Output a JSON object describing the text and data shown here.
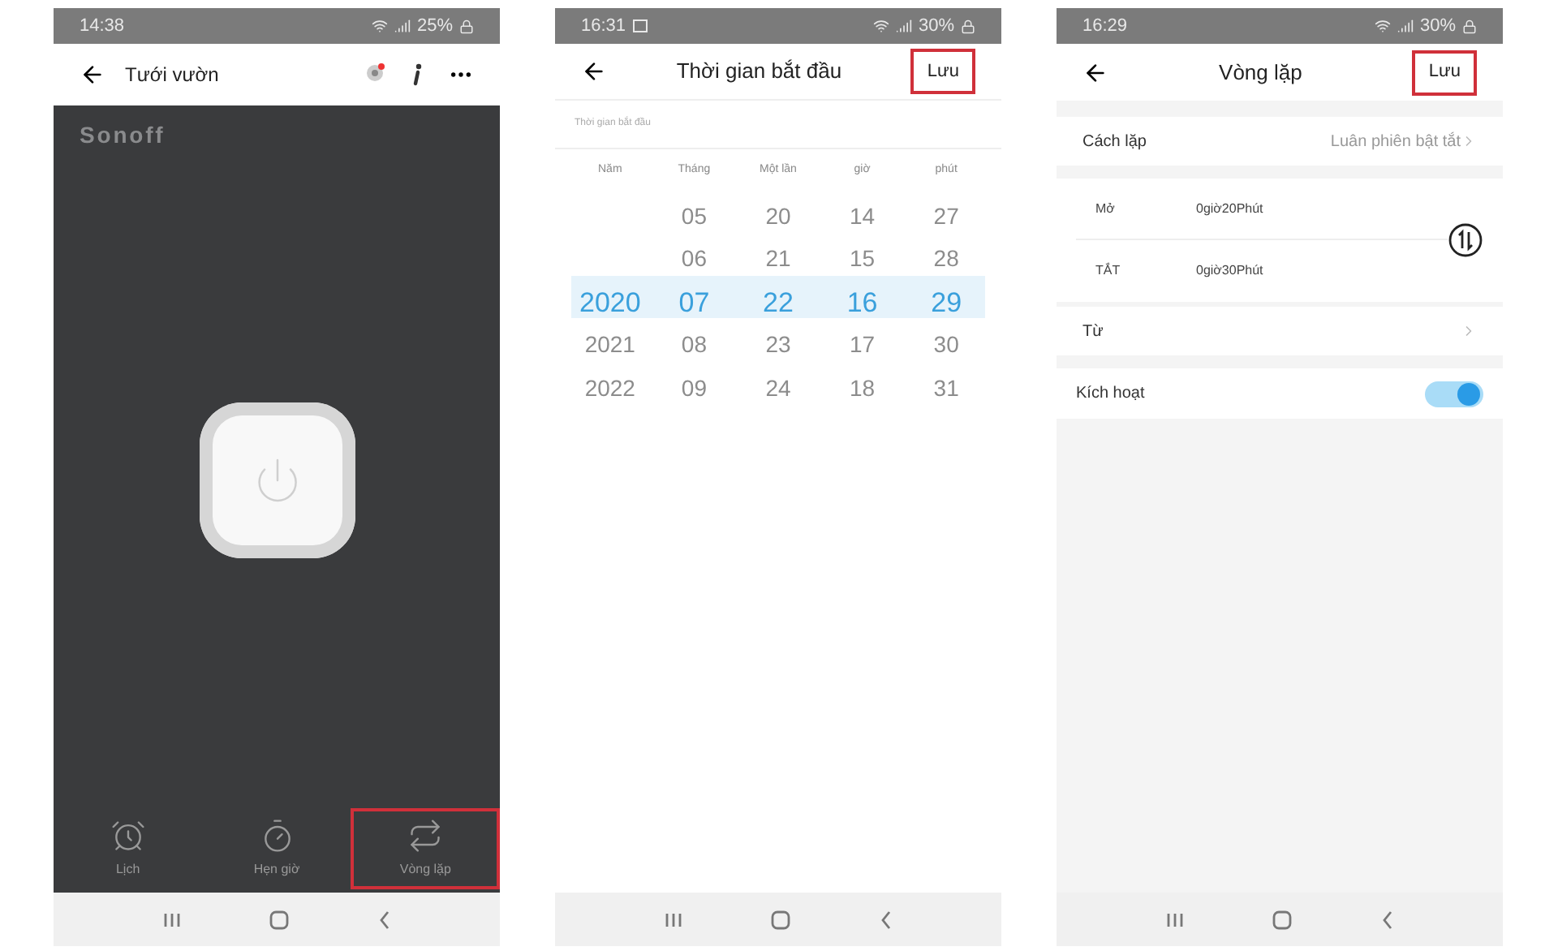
{
  "device_screen": {
    "status": {
      "time": "14:38",
      "battery": "25%"
    },
    "title": "Tưới vườn",
    "logo": "Sonoff",
    "power_on": false,
    "tabs": [
      {
        "kind": "alarm",
        "label": "Lịch",
        "highlighted": false
      },
      {
        "kind": "timer",
        "label": "Hẹn giờ",
        "highlighted": false
      },
      {
        "kind": "repeat",
        "label": "Vòng lặp",
        "highlighted": true
      }
    ]
  },
  "time_picker_screen": {
    "status": {
      "time": "16:31",
      "battery": "30%"
    },
    "title": "Thời gian bắt đầu",
    "save": {
      "label": "Lưu",
      "highlighted": true
    },
    "subtitle": "Thời gian bắt đầu",
    "columns": [
      {
        "label": "Năm",
        "items": [
          {
            "value": "2020",
            "selected": true
          },
          {
            "value": "2021",
            "selected": false
          },
          {
            "value": "2022",
            "selected": false
          }
        ]
      },
      {
        "label": "Tháng",
        "items": [
          {
            "value": "05",
            "selected": false
          },
          {
            "value": "06",
            "selected": false
          },
          {
            "value": "07",
            "selected": true
          },
          {
            "value": "08",
            "selected": false
          },
          {
            "value": "09",
            "selected": false
          }
        ]
      },
      {
        "label": "Một lần",
        "items": [
          {
            "value": "20",
            "selected": false
          },
          {
            "value": "21",
            "selected": false
          },
          {
            "value": "22",
            "selected": true
          },
          {
            "value": "23",
            "selected": false
          },
          {
            "value": "24",
            "selected": false
          }
        ]
      },
      {
        "label": "giờ",
        "items": [
          {
            "value": "14",
            "selected": false
          },
          {
            "value": "15",
            "selected": false
          },
          {
            "value": "16",
            "selected": true
          },
          {
            "value": "17",
            "selected": false
          },
          {
            "value": "18",
            "selected": false
          }
        ]
      },
      {
        "label": "phút",
        "items": [
          {
            "value": "27",
            "selected": false
          },
          {
            "value": "28",
            "selected": false
          },
          {
            "value": "29",
            "selected": true
          },
          {
            "value": "30",
            "selected": false
          },
          {
            "value": "31",
            "selected": false
          }
        ]
      }
    ]
  },
  "loop_screen": {
    "status": {
      "time": "16:29",
      "battery": "30%"
    },
    "title": "Vòng lặp",
    "save": {
      "label": "Lưu",
      "highlighted": true
    },
    "mode": {
      "label": "Cách lặp",
      "value": "Luân phiên bật tắt"
    },
    "durations": [
      {
        "label": "Mở",
        "value": "0giờ20Phút"
      },
      {
        "label": "TẮT",
        "value": "0giờ30Phút"
      }
    ],
    "from": {
      "label": "Từ"
    },
    "enable": {
      "label": "Kích hoạt",
      "on": true
    }
  }
}
